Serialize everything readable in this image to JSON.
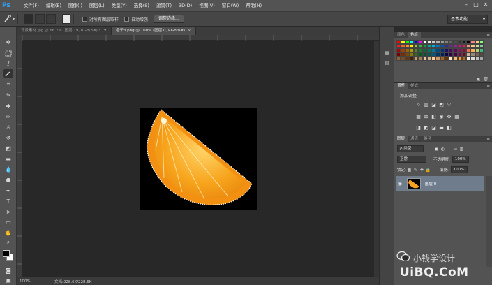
{
  "app": {
    "logo": "Ps"
  },
  "menubar": {
    "items": [
      "文件(F)",
      "编辑(E)",
      "图像(I)",
      "图层(L)",
      "类型(Y)",
      "选择(S)",
      "滤镜(T)",
      "3D(D)",
      "视图(V)",
      "窗口(W)",
      "帮助(H)"
    ],
    "controls": [
      "–",
      "□",
      "✕"
    ]
  },
  "options": {
    "sample_all_layers": "对所有图层取样",
    "auto_enhance": "自动增强",
    "refine_edge": "调整边缘...",
    "workspace": "基本功能"
  },
  "tabs": [
    {
      "label": "背景素材.jpg @ 66.7% (图层 19, RGB/8#) *",
      "close": "×"
    },
    {
      "label": "橙子3.png @ 100% (图层 0, RGB/8#)",
      "close": "×"
    }
  ],
  "status": {
    "zoom": "100%",
    "doc": "文档:228.6K/228.6K"
  },
  "panels": {
    "color_tabs": [
      "颜色",
      "色板"
    ],
    "adjust_tabs": [
      "调整",
      "样式"
    ],
    "adjust_title": "添加调整",
    "layers_tabs": [
      "图层",
      "通道",
      "路径"
    ],
    "filter_kind": "ρ 类型",
    "blend_mode": "正常",
    "opacity_label": "不透明度:",
    "opacity_value": "100%",
    "lock_label": "锁定:",
    "fill_label": "填充:",
    "fill_value": "100%",
    "layer_name": "图层 0"
  },
  "watermark": {
    "title": "小钱学设计",
    "site": "UiBQ.CoM"
  },
  "colors": {
    "ps_blue": "#31a8ff",
    "selected_layer": "#6e7c8c",
    "orange": "#f5a020"
  },
  "swatches": [
    "#ff0000",
    "#ffff00",
    "#00ff00",
    "#00ffff",
    "#0000ff",
    "#ff00ff",
    "#ffffff",
    "#e6e6e6",
    "#cccccc",
    "#b3b3b3",
    "#999999",
    "#808080",
    "#666666",
    "#4d4d4d",
    "#333333",
    "#1a1a1a",
    "#000000",
    "#ff8080",
    "#ffd480",
    "#80ff80",
    "#ed1c24",
    "#f26522",
    "#f7941d",
    "#fff200",
    "#8dc63f",
    "#39b54a",
    "#00a651",
    "#00a99d",
    "#00aeef",
    "#0072bc",
    "#0054a6",
    "#2e3192",
    "#662d91",
    "#92278f",
    "#ec008c",
    "#ed145b",
    "#f69679",
    "#fdc689",
    "#c4df9b",
    "#82ca9c",
    "#9e0b0f",
    "#a0410d",
    "#a36209",
    "#aba000",
    "#598527",
    "#197b30",
    "#007236",
    "#00746b",
    "#0076a3",
    "#004a80",
    "#003471",
    "#1b1464",
    "#440e62",
    "#630460",
    "#9e005d",
    "#9e0039",
    "#f26c4f",
    "#fbaf5d",
    "#acd373",
    "#3cb878",
    "#790000",
    "#7b2e00",
    "#7d4900",
    "#827b00",
    "#406618",
    "#005e20",
    "#005826",
    "#005952",
    "#005b7f",
    "#003663",
    "#002157",
    "#0d004c",
    "#32004b",
    "#4b0049",
    "#7b0046",
    "#7a0026",
    "#c7b299",
    "#998675",
    "#736357",
    "#534741",
    "#8c6239",
    "#754c24",
    "#603913",
    "#42210b",
    "#c69c6d",
    "#a67c52",
    "#e6c9a8",
    "#d2b48c",
    "#ffcc99",
    "#cc9966",
    "#996633",
    "#663300",
    "#ffe5cc",
    "#ffb366",
    "#ff9933",
    "#cc6600",
    "#f2f2f2",
    "#d9d9d9",
    "#bfbfbf",
    "#a6a6a6"
  ]
}
